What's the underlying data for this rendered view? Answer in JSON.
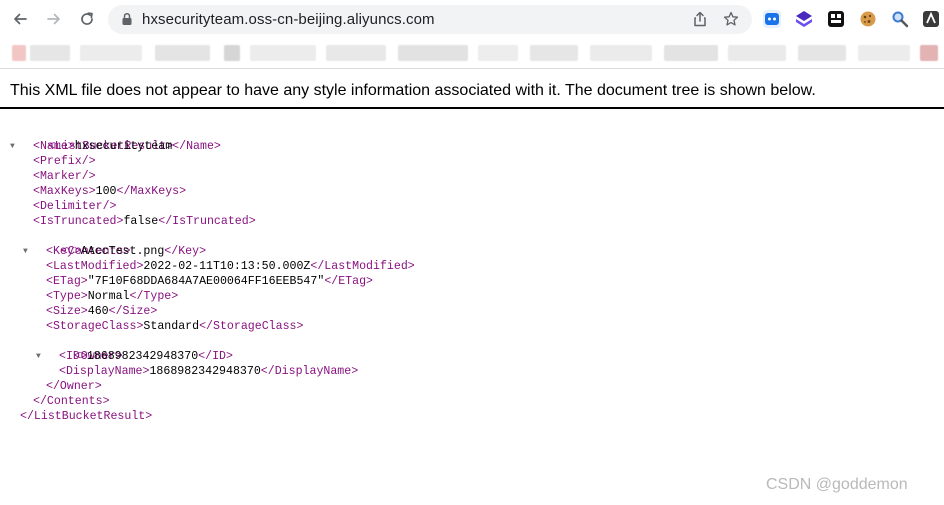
{
  "browser": {
    "url": "hxsecurityteam.oss-cn-beijing.aliyuncs.com",
    "icons": [
      "back-arrow-icon",
      "forward-arrow-icon",
      "reload-icon",
      "lock-icon",
      "share-icon",
      "bookmark-star-icon"
    ],
    "extensions": [
      "extension-icon-1",
      "extension-icon-2",
      "extension-icon-3",
      "extension-icon-4",
      "extension-icon-5",
      "extension-icon-6"
    ]
  },
  "page": {
    "notice": "This XML file does not appear to have any style information associated with it. The document tree is shown below."
  },
  "xml": {
    "root_open": "<ListBucketResult>",
    "root_close": "</ListBucketResult>",
    "name_open": "<Name>",
    "name_value": "hxsecurityteam",
    "name_close": "</Name>",
    "prefix": "<Prefix/>",
    "marker": "<Marker/>",
    "maxkeys_open": "<MaxKeys>",
    "maxkeys_value": "100",
    "maxkeys_close": "</MaxKeys>",
    "delimiter": "<Delimiter/>",
    "istruncated_open": "<IsTruncated>",
    "istruncated_value": "false",
    "istruncated_close": "</IsTruncated>",
    "contents_open": "<Contents>",
    "contents_close": "</Contents>",
    "key_open": "<Key>",
    "key_value": "AAccTest.png",
    "key_close": "</Key>",
    "lastmodified_open": "<LastModified>",
    "lastmodified_value": "2022-02-11T10:13:50.000Z",
    "lastmodified_close": "</LastModified>",
    "etag_open": "<ETag>",
    "etag_value": "\"7F10F68DDA684A7AE00064FF16EEB547\"",
    "etag_close": "</ETag>",
    "type_open": "<Type>",
    "type_value": "Normal",
    "type_close": "</Type>",
    "size_open": "<Size>",
    "size_value": "460",
    "size_close": "</Size>",
    "storageclass_open": "<StorageClass>",
    "storageclass_value": "Standard",
    "storageclass_close": "</StorageClass>",
    "owner_open": "<Owner>",
    "owner_close": "</Owner>",
    "id_open": "<ID>",
    "id_value": "1868982342948370",
    "id_close": "</ID>",
    "displayname_open": "<DisplayName>",
    "displayname_value": "1868982342948370",
    "displayname_close": "</DisplayName>"
  },
  "watermark": "CSDN @goddemon"
}
